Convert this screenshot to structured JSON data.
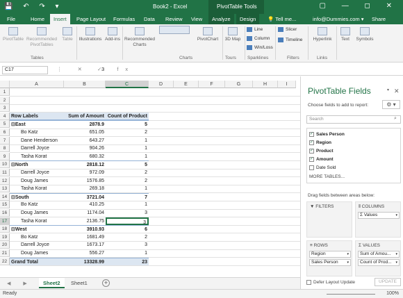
{
  "titlebar": {
    "title": "Book2 - Excel",
    "context_tools": "PivotTable Tools",
    "quick_access": "💾 ↶ ↷ ▾",
    "window_controls": "▢ — ◻ ✕"
  },
  "tabs": {
    "file": "File",
    "home": "Home",
    "insert": "Insert",
    "page_layout": "Page Layout",
    "formulas": "Formulas",
    "data": "Data",
    "review": "Review",
    "view": "View",
    "analyze": "Analyze",
    "design": "Design",
    "tell_me": "💡 Tell me...",
    "account": "info@Dummies.com ▾",
    "share": "Share"
  },
  "ribbon": {
    "pivottable": "PivotTable",
    "recommended_pivottables": "Recommended PivotTables",
    "table": "Table",
    "tables_group": "Tables",
    "illustrations": "Illustrations",
    "addins": "Add-ins",
    "recommended_charts": "Recommended Charts",
    "pivotchart": "PivotChart",
    "charts_group": "Charts",
    "map3d": "3D Map",
    "tours_group": "Tours",
    "line": "Line",
    "column": "Column",
    "winloss": "Win/Loss",
    "sparklines_group": "Sparklines",
    "slicer": "Slicer",
    "timeline": "Timeline",
    "filters_group": "Filters",
    "hyperlink": "Hyperlink",
    "links_group": "Links",
    "text": "Text",
    "symbols": "Symbols"
  },
  "formula_bar": {
    "name_box": "C17",
    "value": "3",
    "icons": "⋮ ✕ ✓ fx"
  },
  "columns": [
    "A",
    "B",
    "C",
    "D",
    "E",
    "F",
    "G",
    "H",
    "I"
  ],
  "rows": [
    {
      "n": "1",
      "a": "",
      "b": "",
      "c": ""
    },
    {
      "n": "2",
      "a": "",
      "b": "",
      "c": ""
    },
    {
      "n": "3",
      "a": "",
      "b": "",
      "c": ""
    },
    {
      "n": "4",
      "a": "Row Labels",
      "b": "Sum of Amount",
      "c": "Count of Product"
    },
    {
      "n": "5",
      "a": "⊟East",
      "b": "2878.9",
      "c": "5"
    },
    {
      "n": "6",
      "a": "Bo Katz",
      "b": "651.05",
      "c": "2"
    },
    {
      "n": "7",
      "a": "Dane Henderson",
      "b": "643.27",
      "c": "1"
    },
    {
      "n": "8",
      "a": "Darrell Joyce",
      "b": "904.26",
      "c": "1"
    },
    {
      "n": "9",
      "a": "Tasha Korat",
      "b": "680.32",
      "c": "1"
    },
    {
      "n": "10",
      "a": "⊟North",
      "b": "2818.12",
      "c": "5"
    },
    {
      "n": "11",
      "a": "Darrell Joyce",
      "b": "972.09",
      "c": "2"
    },
    {
      "n": "12",
      "a": "Doug James",
      "b": "1576.85",
      "c": "2"
    },
    {
      "n": "13",
      "a": "Tasha Korat",
      "b": "269.18",
      "c": "1"
    },
    {
      "n": "14",
      "a": "⊟South",
      "b": "3721.04",
      "c": "7"
    },
    {
      "n": "15",
      "a": "Bo Katz",
      "b": "410.25",
      "c": "1"
    },
    {
      "n": "16",
      "a": "Doug James",
      "b": "1174.04",
      "c": "3"
    },
    {
      "n": "17",
      "a": "Tasha Korat",
      "b": "2136.75",
      "c": "3"
    },
    {
      "n": "18",
      "a": "⊟West",
      "b": "3910.93",
      "c": "6"
    },
    {
      "n": "19",
      "a": "Bo Katz",
      "b": "1681.49",
      "c": "2"
    },
    {
      "n": "20",
      "a": "Darrell Joyce",
      "b": "1673.17",
      "c": "3"
    },
    {
      "n": "21",
      "a": "Doug James",
      "b": "556.27",
      "c": "1"
    },
    {
      "n": "22",
      "a": "Grand Total",
      "b": "13328.99",
      "c": "23"
    }
  ],
  "sheets": {
    "nav": "◀ ▶",
    "sheet2": "Sheet2",
    "sheet1": "Sheet1",
    "add": "+"
  },
  "status": {
    "ready": "Ready",
    "zoom": "100%"
  },
  "pane": {
    "title": "PivotTable Fields",
    "close": "✕",
    "dropdown": "▾",
    "choose": "Choose fields to add to report:",
    "gear": "⚙ ▾",
    "search_placeholder": "Search",
    "search_icon": "⌕",
    "fields": [
      {
        "label": "Sales Person",
        "checked": true,
        "mark": "✓"
      },
      {
        "label": "Region",
        "checked": true,
        "mark": "✓"
      },
      {
        "label": "Product",
        "checked": true,
        "mark": "✓"
      },
      {
        "label": "Amount",
        "checked": true,
        "mark": "✓"
      },
      {
        "label": "Date Sold",
        "checked": false,
        "mark": ""
      }
    ],
    "more_tables": "MORE TABLES...",
    "drag_text": "Drag fields between areas below:",
    "filters": "▼ FILTERS",
    "columns": "⦀ COLUMNS",
    "rows": "≡ ROWS",
    "values": "Σ VALUES",
    "columns_chip": "Σ  Values",
    "rows_chips": [
      "Region",
      "Sales Person"
    ],
    "values_chips": [
      "Sum of Amou...",
      "Count of Prod..."
    ],
    "chip_dd": "▾",
    "defer": "Defer Layout Update",
    "update": "UPDATE"
  }
}
